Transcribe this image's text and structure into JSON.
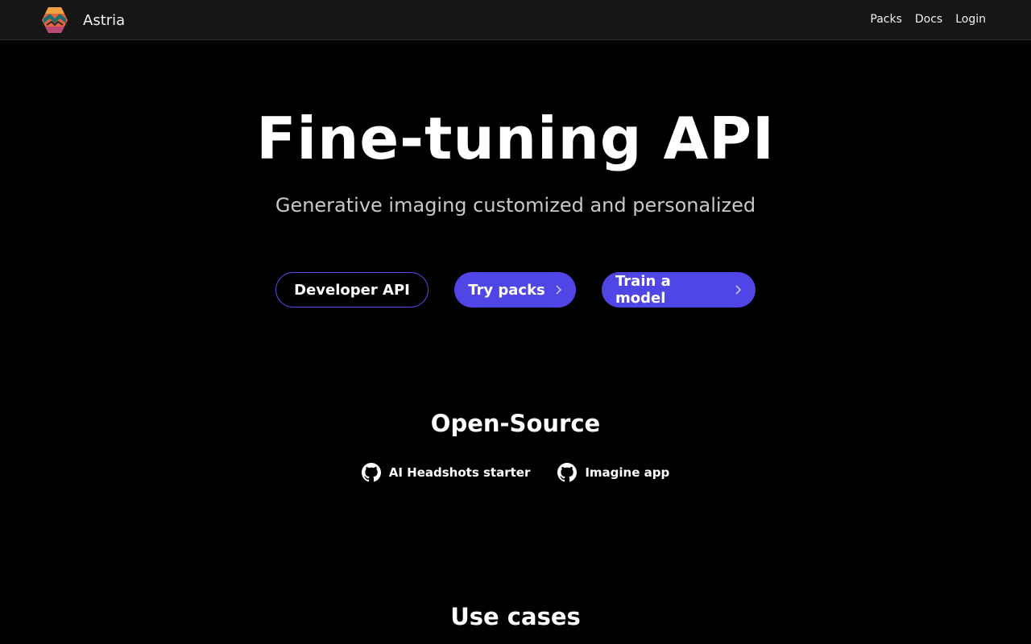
{
  "nav": {
    "brand": "Astria",
    "links": [
      "Packs",
      "Docs",
      "Login"
    ]
  },
  "hero": {
    "title": "Fine-tuning API",
    "subtitle": "Generative imaging customized and personalized",
    "buttons": {
      "developer_api": "Developer API",
      "try_packs": "Try packs",
      "train_model": "Train a model"
    }
  },
  "open_source": {
    "title": "Open-Source",
    "links": [
      "AI Headshots starter",
      "Imagine app"
    ],
    "icon": "github-icon"
  },
  "use_cases": {
    "title": "Use cases"
  },
  "colors": {
    "background": "#000000",
    "navbar": "#161616",
    "accent": "#4f46e5",
    "outline": "#5b4ff0",
    "subtitle": "#c8c8c8"
  }
}
